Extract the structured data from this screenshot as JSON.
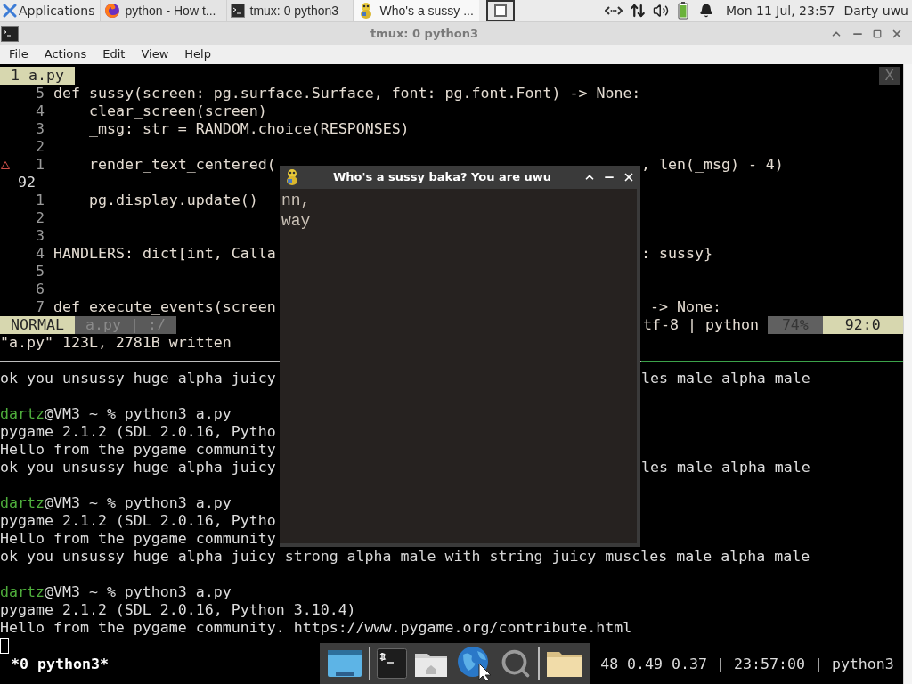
{
  "top_panel": {
    "applications": "Applications",
    "tasks": [
      {
        "kind": "browser",
        "label": "python - How t...",
        "selected": false
      },
      {
        "kind": "terminal",
        "label": "tmux: 0 python3",
        "selected": false
      },
      {
        "kind": "game",
        "label": "Who's a sussy ...",
        "selected": true
      }
    ],
    "clock": "Mon 11 Jul, 23:57",
    "user": "Darty uwu"
  },
  "terminal_window": {
    "title": "tmux: 0 python3",
    "menu": [
      "File",
      "Actions",
      "Edit",
      "View",
      "Help"
    ]
  },
  "vim": {
    "tab": "1 a.py",
    "close": "X",
    "lines": [
      {
        "kind": "relative",
        "number": "5",
        "left": "def sussy(screen: pg.surface.Surface, font: pg.font.Font) -> None:"
      },
      {
        "kind": "relative",
        "number": "4",
        "left": "    clear_screen(screen)"
      },
      {
        "kind": "relative",
        "number": "3",
        "left": "    _msg: str = RANDOM.choice(RESPONSES)"
      },
      {
        "kind": "relative",
        "number": "2"
      },
      {
        "kind": "relative",
        "number": "1",
        "warning": true,
        "left": "    render_text_centered(",
        "right": ", len(_msg) - 4)"
      },
      {
        "kind": "current",
        "number": "92"
      },
      {
        "kind": "relative",
        "number": "1",
        "left": "    pg.display.update()"
      },
      {
        "kind": "relative",
        "number": "2"
      },
      {
        "kind": "relative",
        "number": "3"
      },
      {
        "kind": "relative",
        "number": "4",
        "left": "HANDLERS: dict[int, Calla",
        "right": ": sussy}"
      },
      {
        "kind": "relative",
        "number": "5"
      },
      {
        "kind": "relative",
        "number": "6"
      },
      {
        "kind": "relative",
        "number": "7",
        "left": "def execute_events(screen",
        "right": " -> None:"
      }
    ],
    "status": {
      "mode": "NORMAL",
      "file": "a.py | :/",
      "encoding": "tf-8 | python",
      "percent": "74%",
      "position": "92:0"
    },
    "message": "\"a.py\" 123L, 2781B written"
  },
  "shell": {
    "lines": [
      {
        "kind": "text",
        "left": "ok you unsussy huge alpha juicy",
        "right": "les male alpha male"
      },
      {
        "kind": "blank"
      },
      {
        "kind": "prompt",
        "user": "dartz",
        "left": "@VM3 ~ % python3 a.py"
      },
      {
        "kind": "text",
        "left": "pygame 2.1.2 (SDL 2.0.16, Pytho"
      },
      {
        "kind": "text",
        "left": "Hello from the pygame community"
      },
      {
        "kind": "text",
        "left": "ok you unsussy huge alpha juicy",
        "right": "les male alpha male"
      },
      {
        "kind": "blank"
      },
      {
        "kind": "prompt",
        "user": "dartz",
        "left": "@VM3 ~ % python3 a.py"
      },
      {
        "kind": "text",
        "left": "pygame 2.1.2 (SDL 2.0.16, Pytho"
      },
      {
        "kind": "text",
        "left": "Hello from the pygame community"
      },
      {
        "kind": "text",
        "left": "ok you unsussy huge alpha juicy strong alpha male with string juicy muscles male alpha male"
      },
      {
        "kind": "blank"
      },
      {
        "kind": "prompt",
        "user": "dartz",
        "left": "@VM3 ~ % python3 a.py"
      },
      {
        "kind": "text",
        "left": "pygame 2.1.2 (SDL 2.0.16, Python 3.10.4)"
      },
      {
        "kind": "text",
        "left": "Hello from the pygame community. https://www.pygame.org/contribute.html"
      },
      {
        "kind": "cursor"
      }
    ]
  },
  "tmux_status": {
    "left": "*0 python3*",
    "right": "48 0.49 0.37 | 23:57:00 | python3"
  },
  "game_window": {
    "title": "Who's a sussy baka? You are uwu",
    "lines": [
      "nn,",
      "way"
    ]
  },
  "dock": [
    {
      "kind": "window"
    },
    {
      "kind": "separator"
    },
    {
      "kind": "terminal"
    },
    {
      "kind": "home"
    },
    {
      "kind": "globe"
    },
    {
      "kind": "search"
    },
    {
      "kind": "separator"
    },
    {
      "kind": "folder"
    }
  ]
}
